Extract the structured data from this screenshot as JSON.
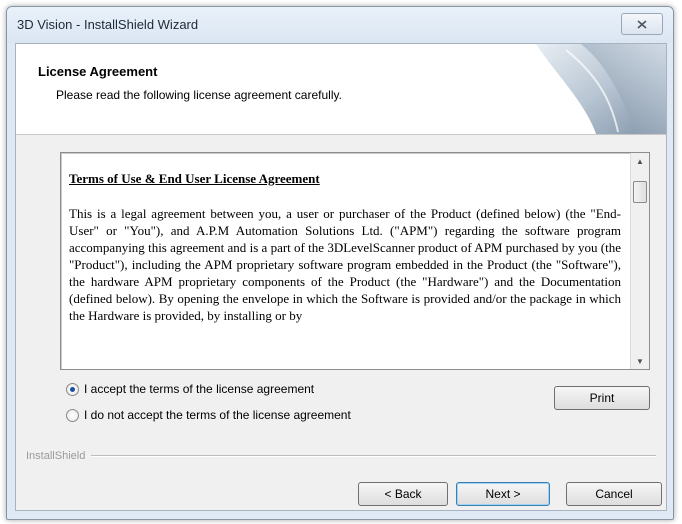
{
  "window": {
    "title": "3D Vision - InstallShield Wizard"
  },
  "header": {
    "title": "License Agreement",
    "subtitle": "Please read the following license agreement carefully."
  },
  "license": {
    "heading": "Terms of Use & End User License Agreement",
    "paragraph": "This is a legal agreement between you, a user or purchaser of the Product (defined below) (the \"End-User\" or \"You\"), and A.P.M Automation Solutions Ltd. (\"APM\") regarding the software program accompanying this agreement and is a part of the 3DLevelScanner product of APM purchased by you (the \"Product\"), including the APM proprietary software program embedded in the Product (the \"Software\"), the hardware APM proprietary components of the Product (the \"Hardware\") and the Documentation (defined below). By opening the envelope in which the Software is provided and/or the package in which the Hardware is provided, by installing or by"
  },
  "options": {
    "accept_label": "I accept the terms of the license agreement",
    "decline_label": "I do not accept the terms of the license agreement",
    "selected": "accept"
  },
  "buttons": {
    "print": "Print",
    "back": "< Back",
    "next": "Next >",
    "cancel": "Cancel"
  },
  "brand": {
    "label": "InstallShield"
  },
  "icons": {
    "close": "close-icon",
    "scroll_up": "scroll-up-arrow-icon",
    "scroll_down": "scroll-down-arrow-icon",
    "header_art": "page-curl-graphic"
  }
}
